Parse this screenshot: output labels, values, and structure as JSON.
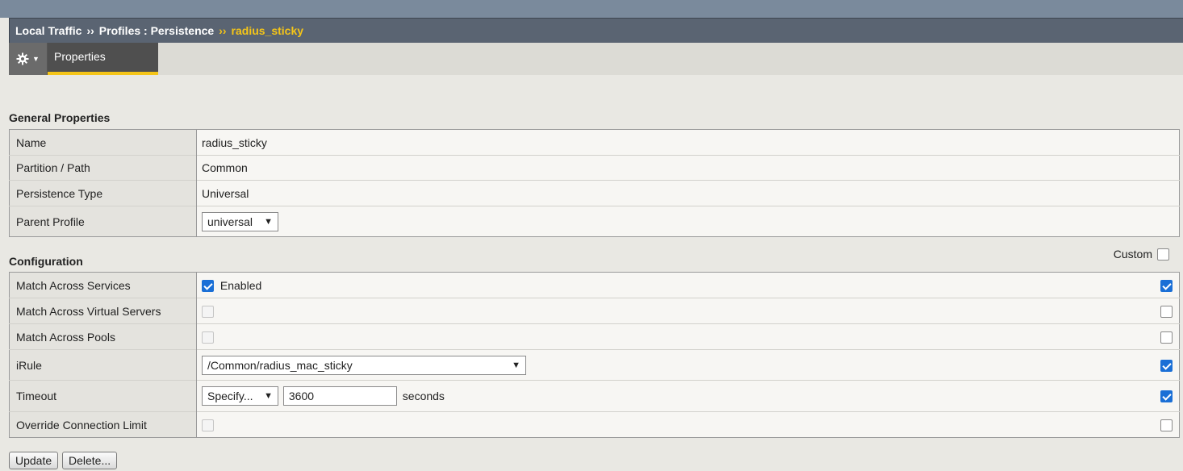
{
  "breadcrumb": {
    "part1": "Local Traffic",
    "sep": "››",
    "part2": "Profiles : Persistence",
    "current": "radius_sticky"
  },
  "tabs": {
    "gear_icon": "gear-icon",
    "properties": "Properties"
  },
  "general": {
    "title": "General Properties",
    "rows": {
      "name": {
        "label": "Name",
        "value": "radius_sticky"
      },
      "partition": {
        "label": "Partition / Path",
        "value": "Common"
      },
      "persistence_type": {
        "label": "Persistence Type",
        "value": "Universal"
      },
      "parent_profile": {
        "label": "Parent Profile",
        "value": "universal"
      }
    }
  },
  "configuration": {
    "title": "Configuration",
    "custom_label": "Custom",
    "rows": {
      "match_services": {
        "label": "Match Across Services",
        "value_text": "Enabled",
        "checked": true,
        "custom": true
      },
      "match_virtual": {
        "label": "Match Across Virtual Servers",
        "checked": false,
        "custom": false
      },
      "match_pools": {
        "label": "Match Across Pools",
        "checked": false,
        "custom": false
      },
      "irule": {
        "label": "iRule",
        "value": "/Common/radius_mac_sticky",
        "custom": true
      },
      "timeout": {
        "label": "Timeout",
        "mode": "Specify...",
        "value": "3600",
        "unit": "seconds",
        "custom": true
      },
      "override_limit": {
        "label": "Override Connection Limit",
        "checked": false,
        "custom": false
      }
    }
  },
  "buttons": {
    "update": "Update",
    "delete": "Delete..."
  },
  "colors": {
    "accent": "#f5c518",
    "header": "#5a6472",
    "checkbox": "#1a6fd6"
  }
}
